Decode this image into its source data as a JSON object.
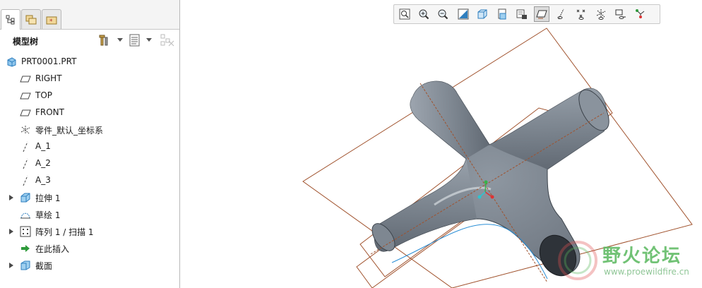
{
  "panel": {
    "title": "模型树",
    "tabs": [
      "model-tree",
      "folder-browser",
      "favorites"
    ]
  },
  "tree": {
    "items": [
      {
        "label": "PRT0001.PRT",
        "icon": "part-icon",
        "expandable": false
      },
      {
        "label": "RIGHT",
        "icon": "datum-plane-icon",
        "expandable": false
      },
      {
        "label": "TOP",
        "icon": "datum-plane-icon",
        "expandable": false
      },
      {
        "label": "FRONT",
        "icon": "datum-plane-icon",
        "expandable": false
      },
      {
        "label": "零件_默认_坐标系",
        "icon": "coordinate-system-icon",
        "expandable": false
      },
      {
        "label": "A_1",
        "icon": "datum-axis-icon",
        "expandable": false
      },
      {
        "label": "A_2",
        "icon": "datum-axis-icon",
        "expandable": false
      },
      {
        "label": "A_3",
        "icon": "datum-axis-icon",
        "expandable": false
      },
      {
        "label": "拉伸 1",
        "icon": "extrude-icon",
        "expandable": true
      },
      {
        "label": "草绘 1",
        "icon": "sketch-icon",
        "expandable": false
      },
      {
        "label": "阵列 1 / 扫描 1",
        "icon": "pattern-icon",
        "expandable": true
      },
      {
        "label": "在此插入",
        "icon": "insert-here-arrow-icon",
        "expandable": false
      },
      {
        "label": "截面",
        "icon": "section-icon",
        "expandable": true
      }
    ]
  },
  "graphics_toolbar": {
    "buttons": [
      {
        "icon": "zoom-fit-icon",
        "pressed": false
      },
      {
        "icon": "zoom-in-icon",
        "pressed": false
      },
      {
        "icon": "zoom-out-icon",
        "pressed": false
      },
      {
        "icon": "repaint-icon",
        "pressed": false
      },
      {
        "icon": "display-style-icon",
        "pressed": false
      },
      {
        "icon": "saved-views-icon",
        "pressed": false
      },
      {
        "icon": "view-manager-icon",
        "pressed": false
      },
      {
        "icon": "plane-display-icon",
        "pressed": true
      },
      {
        "icon": "axis-display-icon",
        "pressed": false
      },
      {
        "icon": "point-display-icon",
        "pressed": false
      },
      {
        "icon": "csys-display-icon",
        "pressed": false
      },
      {
        "icon": "spin-center-icon",
        "pressed": false
      },
      {
        "icon": "annotation-display-icon",
        "pressed": false
      }
    ]
  },
  "watermark": {
    "text": "野火论坛",
    "url": "www.proewildfire.cn"
  },
  "colors": {
    "model_body": "#7e8791",
    "datum_plane": "#a0522d",
    "tree_icon_blue": "#2f7fbf",
    "accent_green": "#4cae4c"
  }
}
